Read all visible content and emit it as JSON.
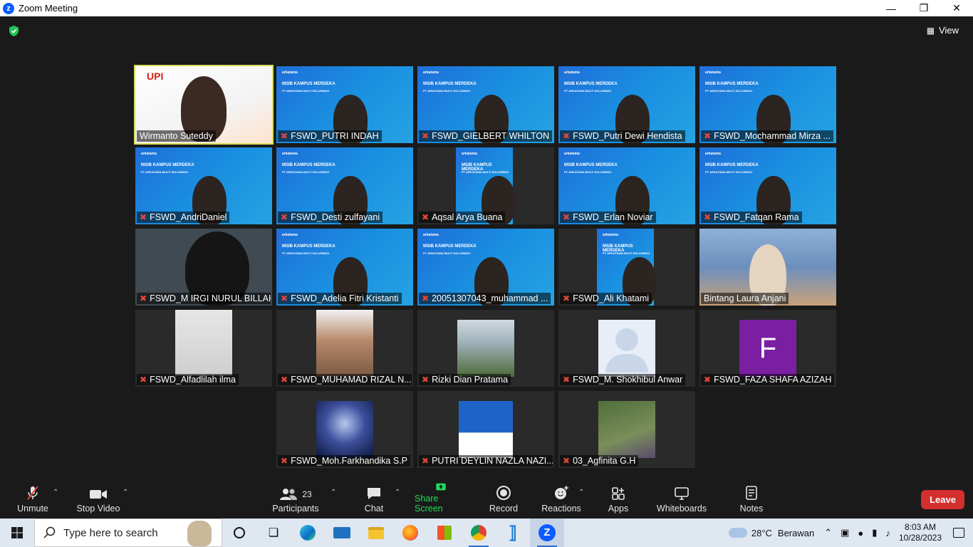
{
  "window": {
    "title": "Zoom Meeting",
    "app_icon": "zoom-icon",
    "controls": [
      "minimize-icon",
      "maximize-icon",
      "close-icon"
    ]
  },
  "meeting": {
    "view_label": "View",
    "banner_brand": "arkatama",
    "banner_title": "MSIB KAMPUS MERDEKA",
    "banner_sub": "PT ARKATAMA MULTI SOLUSINDO",
    "tiles": [
      {
        "name": "Wirmanto Suteddy",
        "muted": false,
        "active": true
      },
      {
        "name": "FSWD_PUTRI INDAH",
        "muted": true
      },
      {
        "name": "FSWD_GIELBERT WHILTON",
        "muted": true
      },
      {
        "name": "FSWD_Putri Dewi Hendista",
        "muted": true
      },
      {
        "name": "FSWD_Mochammad Mirza ...",
        "muted": true
      },
      {
        "name": "FSWD_AndriDaniel",
        "muted": true
      },
      {
        "name": "FSWD_Desti zulfayani",
        "muted": true
      },
      {
        "name": "Aqsal Arya Buana",
        "muted": true
      },
      {
        "name": "FSWD_Erlan Noviar",
        "muted": true
      },
      {
        "name": "FSWD_Fatqan Rama",
        "muted": true
      },
      {
        "name": "FSWD_M IRGI NURUL BILLAH",
        "muted": true
      },
      {
        "name": "FSWD_Adelia Fitri Kristanti",
        "muted": true
      },
      {
        "name": "20051307043_muhammad ...",
        "muted": true
      },
      {
        "name": "FSWD_Ali Khatami",
        "muted": true
      },
      {
        "name": "Bintang Laura Anjani",
        "muted": false
      },
      {
        "name": "FSWD_Alfadlilah ilma",
        "muted": true
      },
      {
        "name": "FSWD_MUHAMAD RIZAL N...",
        "muted": true
      },
      {
        "name": "Rizki Dian Pratama",
        "muted": true
      },
      {
        "name": "FSWD_M. Shokhibul Anwar",
        "muted": true
      },
      {
        "name": "FSWD_FAZA SHAFA AZIZAH",
        "muted": true,
        "avatar_letter": "F"
      },
      {
        "name": "FSWD_Moh.Farkhandika S.P",
        "muted": true
      },
      {
        "name": "PUTRI DEYLIN NAZLA NAZI...",
        "muted": true
      },
      {
        "name": "03_Agfinita G.H",
        "muted": true
      }
    ]
  },
  "toolbar": {
    "unmute": "Unmute",
    "stop_video": "Stop Video",
    "participants": "Participants",
    "participants_count": "23",
    "chat": "Chat",
    "share_screen": "Share Screen",
    "record": "Record",
    "reactions": "Reactions",
    "apps": "Apps",
    "whiteboards": "Whiteboards",
    "notes": "Notes",
    "leave": "Leave"
  },
  "taskbar": {
    "search_placeholder": "Type here to search",
    "weather": "28°C",
    "weather_desc": "Berawan",
    "time": "8:03 AM",
    "date": "10/28/2023"
  },
  "colors": {
    "share_green": "#23d959",
    "leave_red": "#d32f2f",
    "active_speaker": "#d6e05a",
    "muted_red": "#e0463a"
  }
}
